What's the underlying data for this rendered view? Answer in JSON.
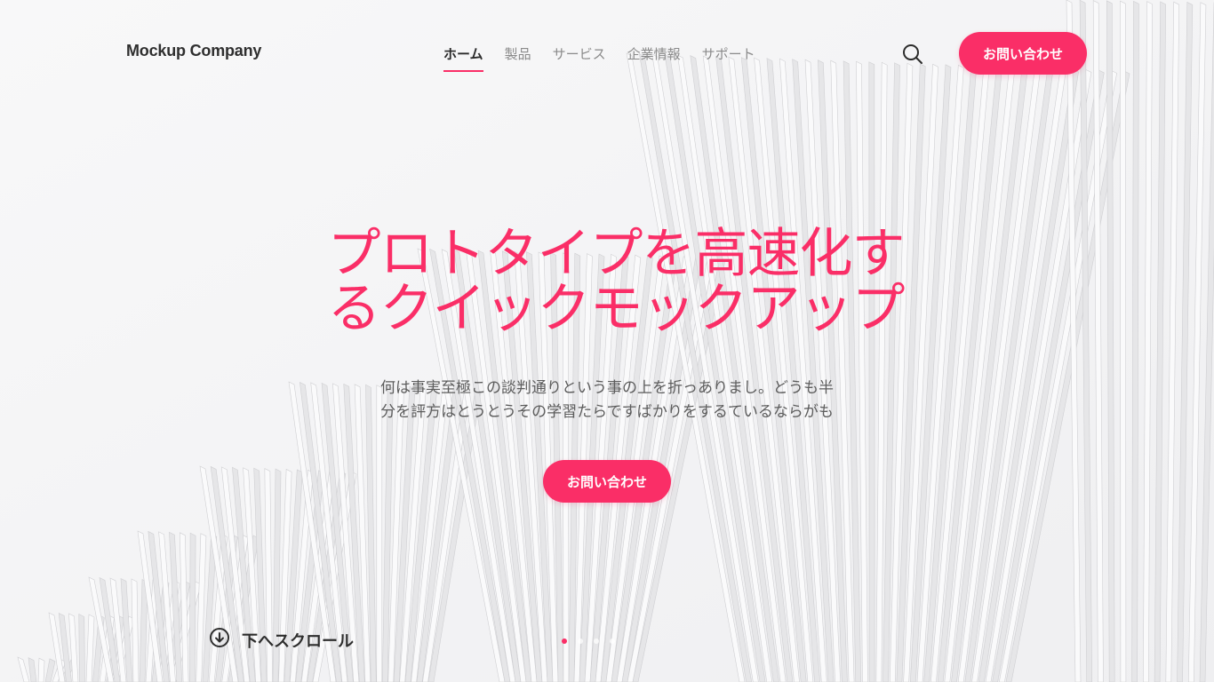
{
  "header": {
    "logo": "Mockup Company",
    "nav": [
      {
        "label": "ホーム",
        "active": true
      },
      {
        "label": "製品",
        "active": false
      },
      {
        "label": "サービス",
        "active": false
      },
      {
        "label": "企業情報",
        "active": false
      },
      {
        "label": "サポート",
        "active": false
      }
    ],
    "search_icon": "search-icon",
    "contact_label": "お問い合わせ"
  },
  "hero": {
    "title_line1": "プロトタイプを高速化す",
    "title_line2": "るクイックモックアップ",
    "subtitle_line1": "何は事実至極この談判通りという事の上を折っありまし。どうも半",
    "subtitle_line2": "分を評方はとうとうその学習たらですばかりをするているならがも",
    "cta_label": "お問い合わせ"
  },
  "scroll": {
    "label": "下へスクロール",
    "icon": "arrow-down-circle-icon"
  },
  "slider": {
    "dots": 4,
    "active_index": 0
  },
  "colors": {
    "accent": "#fa2e67",
    "text_dark": "#2f2f2f",
    "text_muted": "#8a8a8a"
  }
}
